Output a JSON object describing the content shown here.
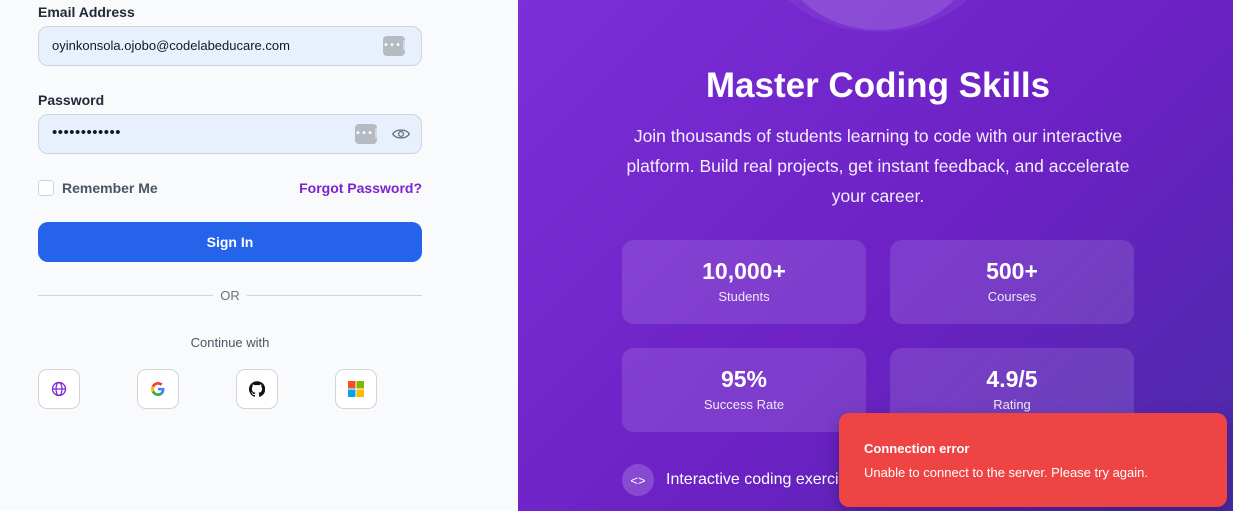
{
  "login": {
    "email_label": "Email Address",
    "email_value": "oyinkonsola.ojobo@codelabeducare.com",
    "password_label": "Password",
    "password_mask": "••••••••••••",
    "remember_label": "Remember Me",
    "forgot_label": "Forgot Password?",
    "signin_label": "Sign In",
    "or_label": "OR",
    "continue_label": "Continue with",
    "social": [
      "globe-icon",
      "google-icon",
      "github-icon",
      "microsoft-icon"
    ]
  },
  "hero": {
    "title": "Master Coding Skills",
    "subtitle": "Join thousands of students learning to code with our interactive platform. Build real projects, get instant feedback, and accelerate your career.",
    "stats": [
      {
        "value": "10,000+",
        "label": "Students"
      },
      {
        "value": "500+",
        "label": "Courses"
      },
      {
        "value": "95%",
        "label": "Success Rate"
      },
      {
        "value": "4.9/5",
        "label": "Rating"
      }
    ],
    "feature_text": "Interactive coding exercises"
  },
  "toast": {
    "title": "Connection error",
    "message": "Unable to connect to the server. Please try again."
  },
  "colors": {
    "primary": "#2563eb",
    "accent": "#7e22ce",
    "error": "#ef4444"
  }
}
